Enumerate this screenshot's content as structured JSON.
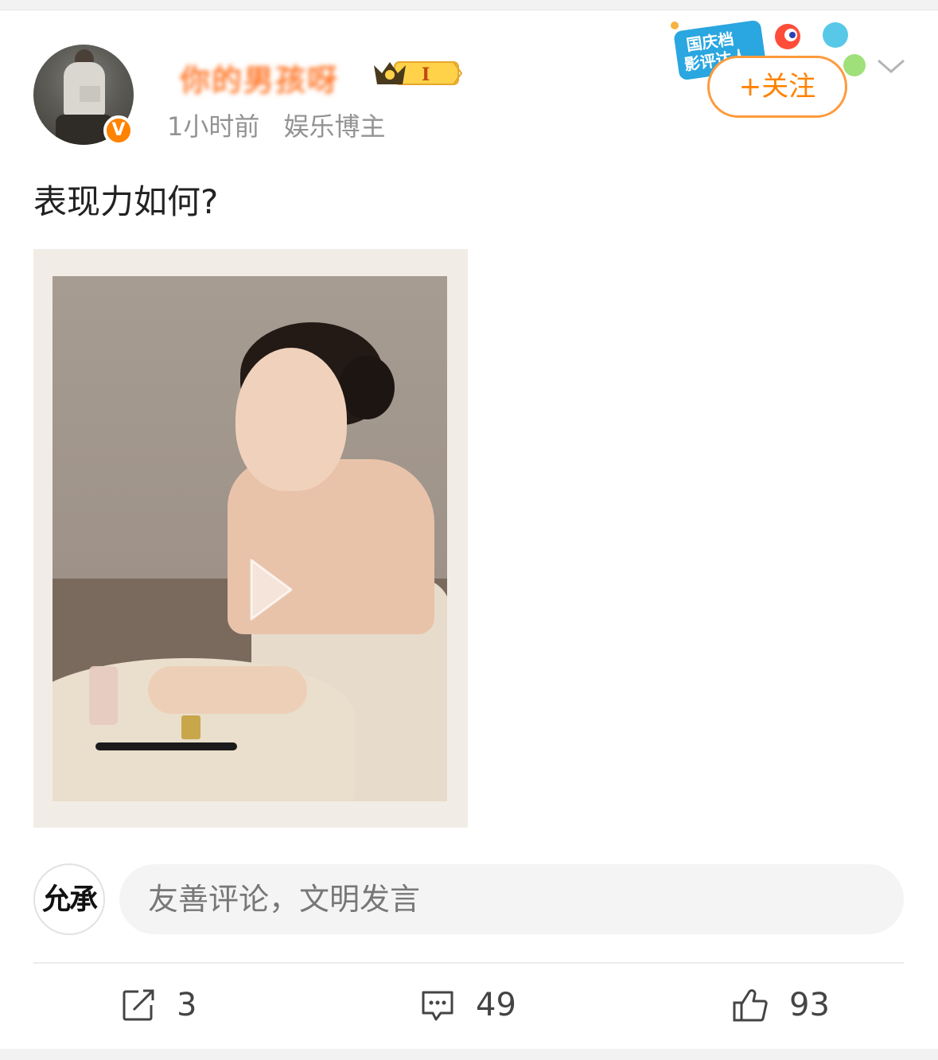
{
  "post": {
    "username": "你的男孩呀",
    "rank_level": "I",
    "time": "1小时前",
    "role": "娱乐博主",
    "verified_badge": "V",
    "follow_label": "+关注",
    "promo_text": "国庆档 影评达人",
    "text": "表现力如何?"
  },
  "composer": {
    "avatar_text": "允承",
    "placeholder": "友善评论，文明发言"
  },
  "actions": {
    "repost_count": "3",
    "comment_count": "49",
    "like_count": "93"
  },
  "icons": {
    "repost": "share-icon",
    "comment": "comment-icon",
    "like": "thumbs-up-icon",
    "menu": "chevron-down-icon",
    "play": "play-icon"
  },
  "colors": {
    "accent": "#ff8200",
    "secondary_text": "#939393"
  }
}
